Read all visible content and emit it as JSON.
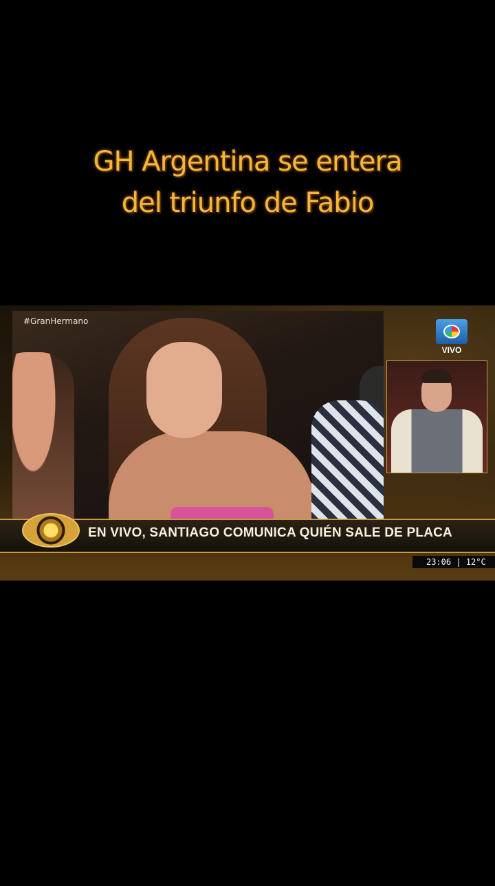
{
  "caption": {
    "line1": "GH Argentina se entera",
    "line2": "del triunfo de Fabio"
  },
  "broadcast": {
    "hashtag": "#GranHermano",
    "channel_logo_icon": "telefe-eye-logo-icon",
    "live_label": "VIVO",
    "headline": "EN VIVO, SANTIAGO COMUNICA QUIÉN SALE DE PLACA",
    "clock": "23:06 | 12°C"
  },
  "colors": {
    "caption": "#f4b73a",
    "accent_gold": "#c79a45"
  }
}
